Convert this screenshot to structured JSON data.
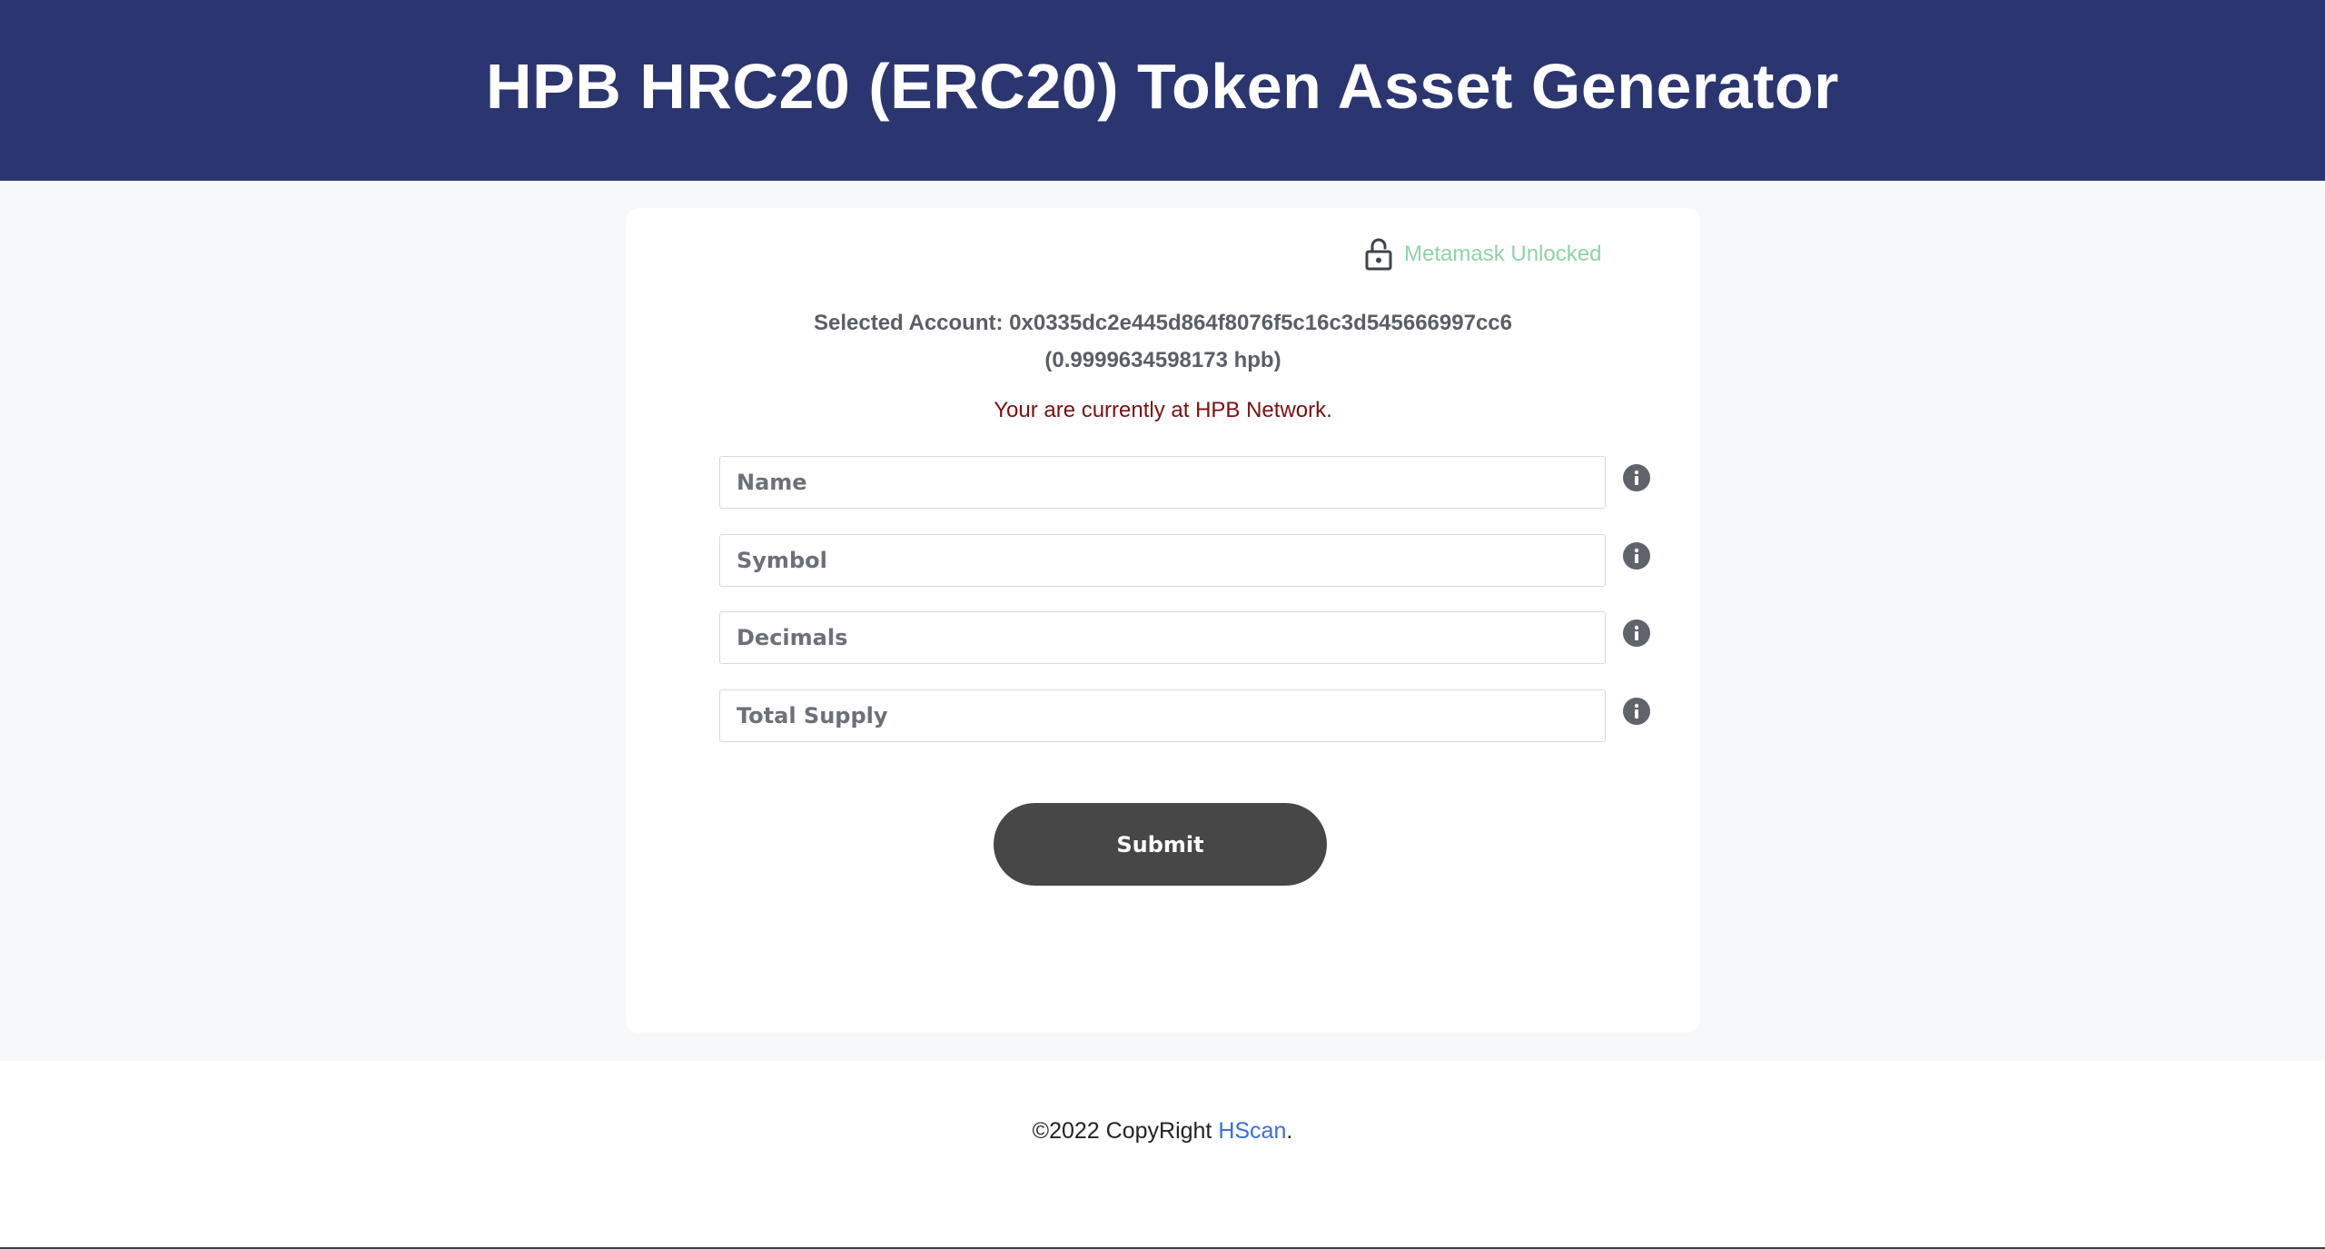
{
  "header": {
    "title": "HPB HRC20 (ERC20) Token Asset Generator"
  },
  "status": {
    "icon": "lock-open-icon",
    "text": "Metamask Unlocked",
    "color": "#8fd2a9"
  },
  "account": {
    "label": "Selected Account: ",
    "address": "0x0335dc2e445d864f8076f5c16c3d545666997cc6",
    "balance": "(0.9999634598173 hpb)"
  },
  "network": {
    "text": "Your are currently at HPB Network."
  },
  "form": {
    "fields": [
      {
        "placeholder": "Name",
        "value": "",
        "icon": "info-icon"
      },
      {
        "placeholder": "Symbol",
        "value": "",
        "icon": "info-icon"
      },
      {
        "placeholder": "Decimals",
        "value": "",
        "icon": "info-icon"
      },
      {
        "placeholder": "Total Supply",
        "value": "",
        "icon": "info-icon"
      }
    ],
    "submit_label": "Submit"
  },
  "footer": {
    "prefix": "©2022 CopyRight ",
    "link_text": "HScan",
    "suffix": "."
  },
  "colors": {
    "header_bg": "#2b3670",
    "submit_bg": "#474747",
    "link": "#3a6fd8",
    "network_text": "#7a1010"
  }
}
